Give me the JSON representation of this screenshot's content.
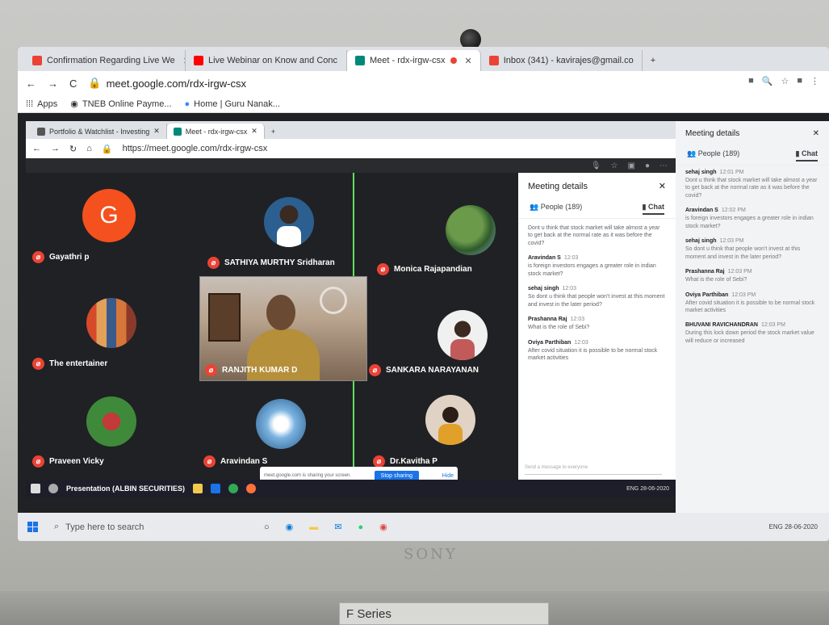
{
  "outer_tabs": [
    {
      "label": "Confirmation Regarding Live We",
      "color": "#ea4335"
    },
    {
      "label": "Live Webinar on Know and Conc",
      "color": "#ff0000"
    },
    {
      "label": "Meet - rdx-irgw-csx",
      "color": "#00897b"
    },
    {
      "label": "Inbox (341) - kavirajes@gmail.co",
      "color": "#ea4335"
    }
  ],
  "outer_address": {
    "url": "meet.google.com/rdx-irgw-csx"
  },
  "bookmarks": [
    {
      "label": "Apps"
    },
    {
      "label": "TNEB Online Payme..."
    },
    {
      "label": "Home | Guru Nanak..."
    }
  ],
  "inner_tabs": [
    {
      "label": "Portfolio & Watchlist - Investing"
    },
    {
      "label": "Meet - rdx-irgw-csx"
    }
  ],
  "inner_address": {
    "url": "https://meet.google.com/rdx-irgw-csx"
  },
  "participants": [
    {
      "name": "Gayathri p",
      "initial": "G"
    },
    {
      "name": "SATHIYA MURTHY Sridharan"
    },
    {
      "name": "Monica Rajapandian"
    },
    {
      "name": "The entertainer"
    },
    {
      "name": "RANJITH KUMAR D"
    },
    {
      "name": "SANKARA NARAYANAN"
    },
    {
      "name": "Praveen Vicky"
    },
    {
      "name": "Aravindan S"
    },
    {
      "name": "Dr.Kavitha P"
    }
  ],
  "share_bar": {
    "text": "meet.google.com is sharing your screen.",
    "stop_label": "Stop sharing",
    "hide_label": "Hide"
  },
  "chat_panel": {
    "title": "Meeting details",
    "people_label": "People (189)",
    "chat_label": "Chat",
    "messages": [
      {
        "sender": "",
        "time": "",
        "text": "Dont u think that stock market will take almost a year to get back at the normal rate as it was before the covid?"
      },
      {
        "sender": "Aravindan S",
        "time": "12:03",
        "text": "is foreign investors engages a greater role in indian stock market?"
      },
      {
        "sender": "sehaj singh",
        "time": "12:03",
        "text": "So dont u think that people won't invest at this moment and invest in the later period?"
      },
      {
        "sender": "Prashanna Raj",
        "time": "12:03",
        "text": "What is the role of Sebi?"
      },
      {
        "sender": "Oviya Parthiban",
        "time": "12:03",
        "text": "After covid situation it is possible to be normal stock market activities"
      }
    ],
    "input_placeholder": "Send a message to everyone"
  },
  "outer_panel": {
    "title": "Meeting details",
    "people_label": "People (189)",
    "chat_label": "Chat",
    "messages": [
      {
        "sender": "sehaj singh",
        "time": "12:01 PM",
        "text": "Dont u think that stock market will take almost a year to get back at the normal rate as it was before the covid?"
      },
      {
        "sender": "Aravindan S",
        "time": "12:02 PM",
        "text": "is foreign investors engages a greater role in indian stock market?"
      },
      {
        "sender": "sehaj singh",
        "time": "12:03 PM",
        "text": "So dont u think that people won't invest at this moment and invest in the later period?"
      },
      {
        "sender": "Prashanna Raj",
        "time": "12:03 PM",
        "text": "What is the role of Sebi?"
      },
      {
        "sender": "Oviya Parthiban",
        "time": "12:03 PM",
        "text": "After covid situation it is possible to be normal stock market activities"
      },
      {
        "sender": "BHUVANI RAVICHANDRAN",
        "time": "12:03 PM",
        "text": "During this lock down period the stock market value will reduce or increased"
      }
    ]
  },
  "inner_taskbar": {
    "presentation_label": "Presentation (ALBIN SECURITIES)",
    "tray": "ENG 28-06-2020"
  },
  "taskbar": {
    "search_placeholder": "Type here to search",
    "tray": "ENG 28-06-2020"
  },
  "laptop": {
    "brand": "SONY",
    "base_label": "F Series"
  }
}
